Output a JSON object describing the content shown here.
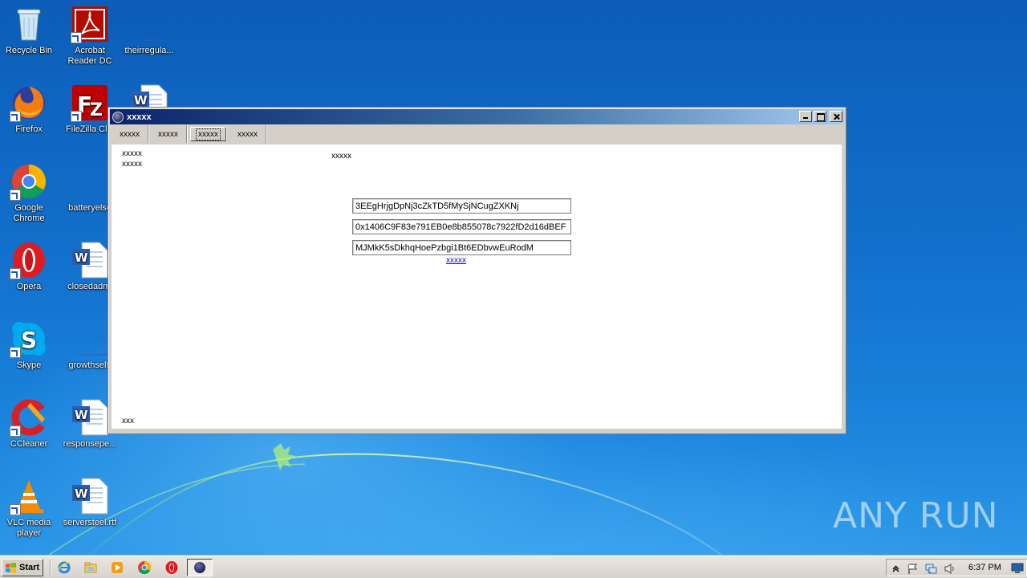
{
  "desktop": {
    "icons": [
      {
        "label": "Recycle Bin",
        "icon": "recycle-bin-icon"
      },
      {
        "label": "Acrobat Reader DC",
        "icon": "acrobat-icon"
      },
      {
        "label": "theirregula...",
        "icon": "blank-document-icon"
      },
      {
        "label": "Firefox",
        "icon": "firefox-icon"
      },
      {
        "label": "FileZilla Clie",
        "icon": "filezilla-icon"
      },
      {
        "label": "",
        "icon": "word-document-icon"
      },
      {
        "label": "Google Chrome",
        "icon": "chrome-icon"
      },
      {
        "label": "batteryelse",
        "icon": "blank-document-icon"
      },
      {
        "label": "Opera",
        "icon": "opera-icon"
      },
      {
        "label": "closedadmi",
        "icon": "word-document-icon"
      },
      {
        "label": "Skype",
        "icon": "skype-icon"
      },
      {
        "label": "growthself.",
        "icon": "blank-document-icon"
      },
      {
        "label": "CCleaner",
        "icon": "ccleaner-icon"
      },
      {
        "label": "responsepe...",
        "icon": "word-document-icon"
      },
      {
        "label": "VLC media player",
        "icon": "vlc-icon"
      },
      {
        "label": "serversteel.rtf",
        "icon": "word-document-icon"
      }
    ],
    "watermark": "ANY RUN"
  },
  "window": {
    "title": "xxxxx",
    "tabs": [
      {
        "label": "xxxxx",
        "active": false
      },
      {
        "label": "xxxxx",
        "active": false
      },
      {
        "label": "xxxxx",
        "active": true
      },
      {
        "label": "xxxxx",
        "active": false
      }
    ],
    "content": {
      "label_1": "xxxxx",
      "label_2": "xxxxx",
      "label_center": "xxxxx",
      "fields": [
        "3EEgHrjgDpNj3cZkTD5fMySjNCugZXKNj",
        "0x1406C9F83e791EB0e8b855078c7922fD2d16dBEF",
        "MJMkK5sDkhqHoePzbgi1Bt6EDbvwEuRodM"
      ],
      "link": "xxxxx",
      "footer": "xxx"
    }
  },
  "taskbar": {
    "start_label": "Start",
    "clock": "6:37 PM"
  }
}
